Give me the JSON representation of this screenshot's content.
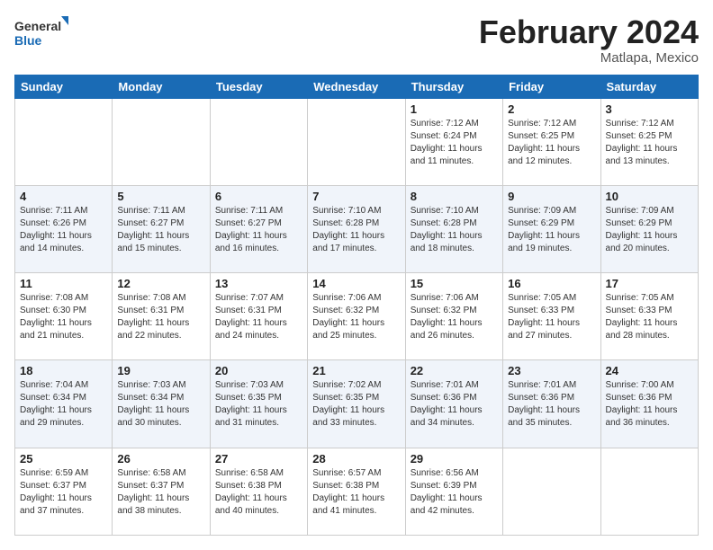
{
  "header": {
    "logo_general": "General",
    "logo_blue": "Blue",
    "title": "February 2024",
    "subtitle": "Matlapa, Mexico"
  },
  "weekdays": [
    "Sunday",
    "Monday",
    "Tuesday",
    "Wednesday",
    "Thursday",
    "Friday",
    "Saturday"
  ],
  "weeks": [
    [
      {
        "day": "",
        "info": ""
      },
      {
        "day": "",
        "info": ""
      },
      {
        "day": "",
        "info": ""
      },
      {
        "day": "",
        "info": ""
      },
      {
        "day": "1",
        "info": "Sunrise: 7:12 AM\nSunset: 6:24 PM\nDaylight: 11 hours and 11 minutes."
      },
      {
        "day": "2",
        "info": "Sunrise: 7:12 AM\nSunset: 6:25 PM\nDaylight: 11 hours and 12 minutes."
      },
      {
        "day": "3",
        "info": "Sunrise: 7:12 AM\nSunset: 6:25 PM\nDaylight: 11 hours and 13 minutes."
      }
    ],
    [
      {
        "day": "4",
        "info": "Sunrise: 7:11 AM\nSunset: 6:26 PM\nDaylight: 11 hours and 14 minutes."
      },
      {
        "day": "5",
        "info": "Sunrise: 7:11 AM\nSunset: 6:27 PM\nDaylight: 11 hours and 15 minutes."
      },
      {
        "day": "6",
        "info": "Sunrise: 7:11 AM\nSunset: 6:27 PM\nDaylight: 11 hours and 16 minutes."
      },
      {
        "day": "7",
        "info": "Sunrise: 7:10 AM\nSunset: 6:28 PM\nDaylight: 11 hours and 17 minutes."
      },
      {
        "day": "8",
        "info": "Sunrise: 7:10 AM\nSunset: 6:28 PM\nDaylight: 11 hours and 18 minutes."
      },
      {
        "day": "9",
        "info": "Sunrise: 7:09 AM\nSunset: 6:29 PM\nDaylight: 11 hours and 19 minutes."
      },
      {
        "day": "10",
        "info": "Sunrise: 7:09 AM\nSunset: 6:29 PM\nDaylight: 11 hours and 20 minutes."
      }
    ],
    [
      {
        "day": "11",
        "info": "Sunrise: 7:08 AM\nSunset: 6:30 PM\nDaylight: 11 hours and 21 minutes."
      },
      {
        "day": "12",
        "info": "Sunrise: 7:08 AM\nSunset: 6:31 PM\nDaylight: 11 hours and 22 minutes."
      },
      {
        "day": "13",
        "info": "Sunrise: 7:07 AM\nSunset: 6:31 PM\nDaylight: 11 hours and 24 minutes."
      },
      {
        "day": "14",
        "info": "Sunrise: 7:06 AM\nSunset: 6:32 PM\nDaylight: 11 hours and 25 minutes."
      },
      {
        "day": "15",
        "info": "Sunrise: 7:06 AM\nSunset: 6:32 PM\nDaylight: 11 hours and 26 minutes."
      },
      {
        "day": "16",
        "info": "Sunrise: 7:05 AM\nSunset: 6:33 PM\nDaylight: 11 hours and 27 minutes."
      },
      {
        "day": "17",
        "info": "Sunrise: 7:05 AM\nSunset: 6:33 PM\nDaylight: 11 hours and 28 minutes."
      }
    ],
    [
      {
        "day": "18",
        "info": "Sunrise: 7:04 AM\nSunset: 6:34 PM\nDaylight: 11 hours and 29 minutes."
      },
      {
        "day": "19",
        "info": "Sunrise: 7:03 AM\nSunset: 6:34 PM\nDaylight: 11 hours and 30 minutes."
      },
      {
        "day": "20",
        "info": "Sunrise: 7:03 AM\nSunset: 6:35 PM\nDaylight: 11 hours and 31 minutes."
      },
      {
        "day": "21",
        "info": "Sunrise: 7:02 AM\nSunset: 6:35 PM\nDaylight: 11 hours and 33 minutes."
      },
      {
        "day": "22",
        "info": "Sunrise: 7:01 AM\nSunset: 6:36 PM\nDaylight: 11 hours and 34 minutes."
      },
      {
        "day": "23",
        "info": "Sunrise: 7:01 AM\nSunset: 6:36 PM\nDaylight: 11 hours and 35 minutes."
      },
      {
        "day": "24",
        "info": "Sunrise: 7:00 AM\nSunset: 6:36 PM\nDaylight: 11 hours and 36 minutes."
      }
    ],
    [
      {
        "day": "25",
        "info": "Sunrise: 6:59 AM\nSunset: 6:37 PM\nDaylight: 11 hours and 37 minutes."
      },
      {
        "day": "26",
        "info": "Sunrise: 6:58 AM\nSunset: 6:37 PM\nDaylight: 11 hours and 38 minutes."
      },
      {
        "day": "27",
        "info": "Sunrise: 6:58 AM\nSunset: 6:38 PM\nDaylight: 11 hours and 40 minutes."
      },
      {
        "day": "28",
        "info": "Sunrise: 6:57 AM\nSunset: 6:38 PM\nDaylight: 11 hours and 41 minutes."
      },
      {
        "day": "29",
        "info": "Sunrise: 6:56 AM\nSunset: 6:39 PM\nDaylight: 11 hours and 42 minutes."
      },
      {
        "day": "",
        "info": ""
      },
      {
        "day": "",
        "info": ""
      }
    ]
  ]
}
